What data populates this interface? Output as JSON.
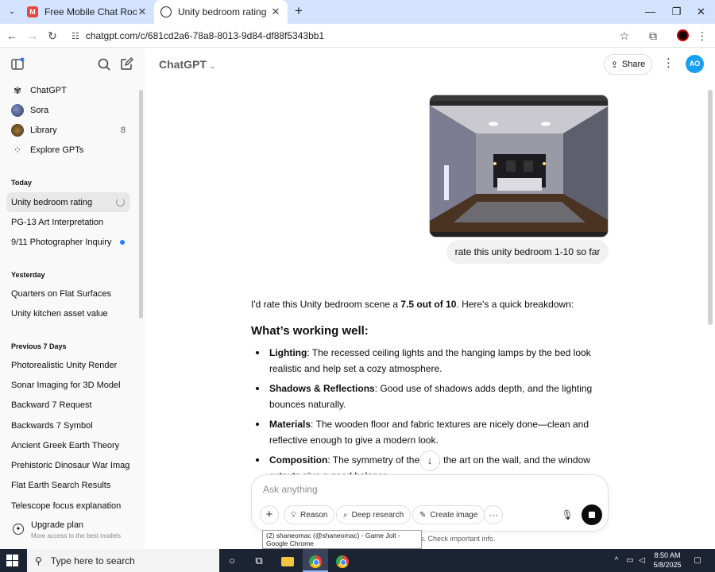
{
  "browser": {
    "tabs": [
      {
        "title": "Free Mobile Chat Rooms",
        "icon": "m-logo-icon"
      },
      {
        "title": "Unity bedroom rating",
        "icon": "chatgpt-logo-icon"
      }
    ],
    "url": "chatgpt.com/c/681cd2a6-78a8-8013-9d84-df88f5343bb1"
  },
  "sidebar": {
    "nav": [
      {
        "label": "ChatGPT"
      },
      {
        "label": "Sora"
      },
      {
        "label": "Library",
        "count": "8"
      },
      {
        "label": "Explore GPTs"
      }
    ],
    "sections": [
      {
        "heading": "Today",
        "items": [
          "Unity bedroom rating",
          "PG-13 Art Interpretation",
          "9/11 Photographer Inquiry"
        ]
      },
      {
        "heading": "Yesterday",
        "items": [
          "Quarters on Flat Surfaces",
          "Unity kitchen asset value"
        ]
      },
      {
        "heading": "Previous 7 Days",
        "items": [
          "Photorealistic Unity Render",
          "Sonar Imaging for 3D Model",
          "Backward 7 Request",
          "Backwards 7 Symbol",
          "Ancient Greek Earth Theory",
          "Prehistoric Dinosaur War Imag",
          "Flat Earth Search Results",
          "Telescope focus explanation"
        ]
      }
    ],
    "upgrade": {
      "title": "Upgrade plan",
      "subtitle": "More access to the best models"
    }
  },
  "header": {
    "model": "ChatGPT",
    "share_label": "Share",
    "avatar_initials": "AO"
  },
  "conversation": {
    "user_message": "rate this unity bedroom 1-10 so far",
    "answer": {
      "intro_before": "I'd rate this Unity bedroom scene a ",
      "intro_bold": "7.5 out of 10",
      "intro_after": ". Here's a quick breakdown:",
      "heading": "What’s working well:",
      "points": [
        {
          "title": "Lighting",
          "text": ": The recessed ceiling lights and the hanging lamps by the bed look realistic and help set a cozy atmosphere."
        },
        {
          "title": "Shadows & Reflections",
          "text": ": Good use of shadows adds depth, and the lighting bounces naturally."
        },
        {
          "title": "Materials",
          "text": ": The wooden floor and fabric textures are nicely done—clean and reflective enough to give a modern look."
        },
        {
          "title": "Composition",
          "text": ": The symmetry of the bed, the art on the wall, and the window cutouts give a good balance."
        }
      ]
    }
  },
  "composer": {
    "placeholder": "Ask anything",
    "tools": [
      "Reason",
      "Deep research",
      "Create image"
    ]
  },
  "disclaimer": "takes. Check important info.",
  "tooltip": "(2) shaneomac (@shaneomac) - Game Jolt - Google Chrome",
  "taskbar": {
    "search_placeholder": "Type here to search",
    "time": "8:50 AM",
    "date": "5/8/2025"
  },
  "colors": {
    "accent": "#2f7bf5",
    "avatar": "#1aa0f0",
    "tabstrip": "#d3e3fd",
    "taskbar": "#1c2333"
  }
}
